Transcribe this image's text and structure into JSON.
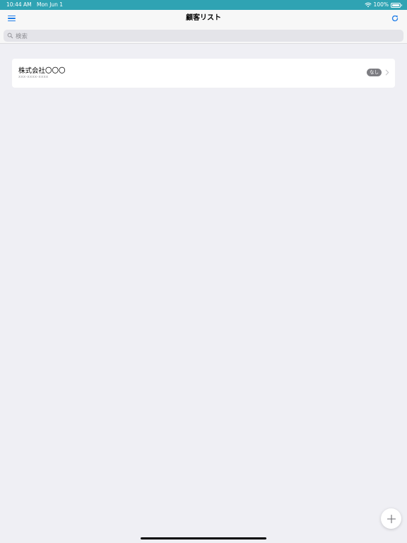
{
  "status_bar": {
    "time": "10:44 AM",
    "date": "Mon Jun 1",
    "battery": "100%",
    "background_color": "#2fa3b3"
  },
  "nav": {
    "title": "顧客リスト",
    "menu_icon": "hamburger-menu-icon",
    "refresh_icon": "refresh-icon",
    "accent_color": "#1e7ce8"
  },
  "search": {
    "placeholder": "検索"
  },
  "customers": [
    {
      "name": "株式会社〇〇〇",
      "phone": "xxx-xxxx-xxxx",
      "badge": "なし"
    }
  ],
  "fab": {
    "icon": "plus-icon"
  }
}
